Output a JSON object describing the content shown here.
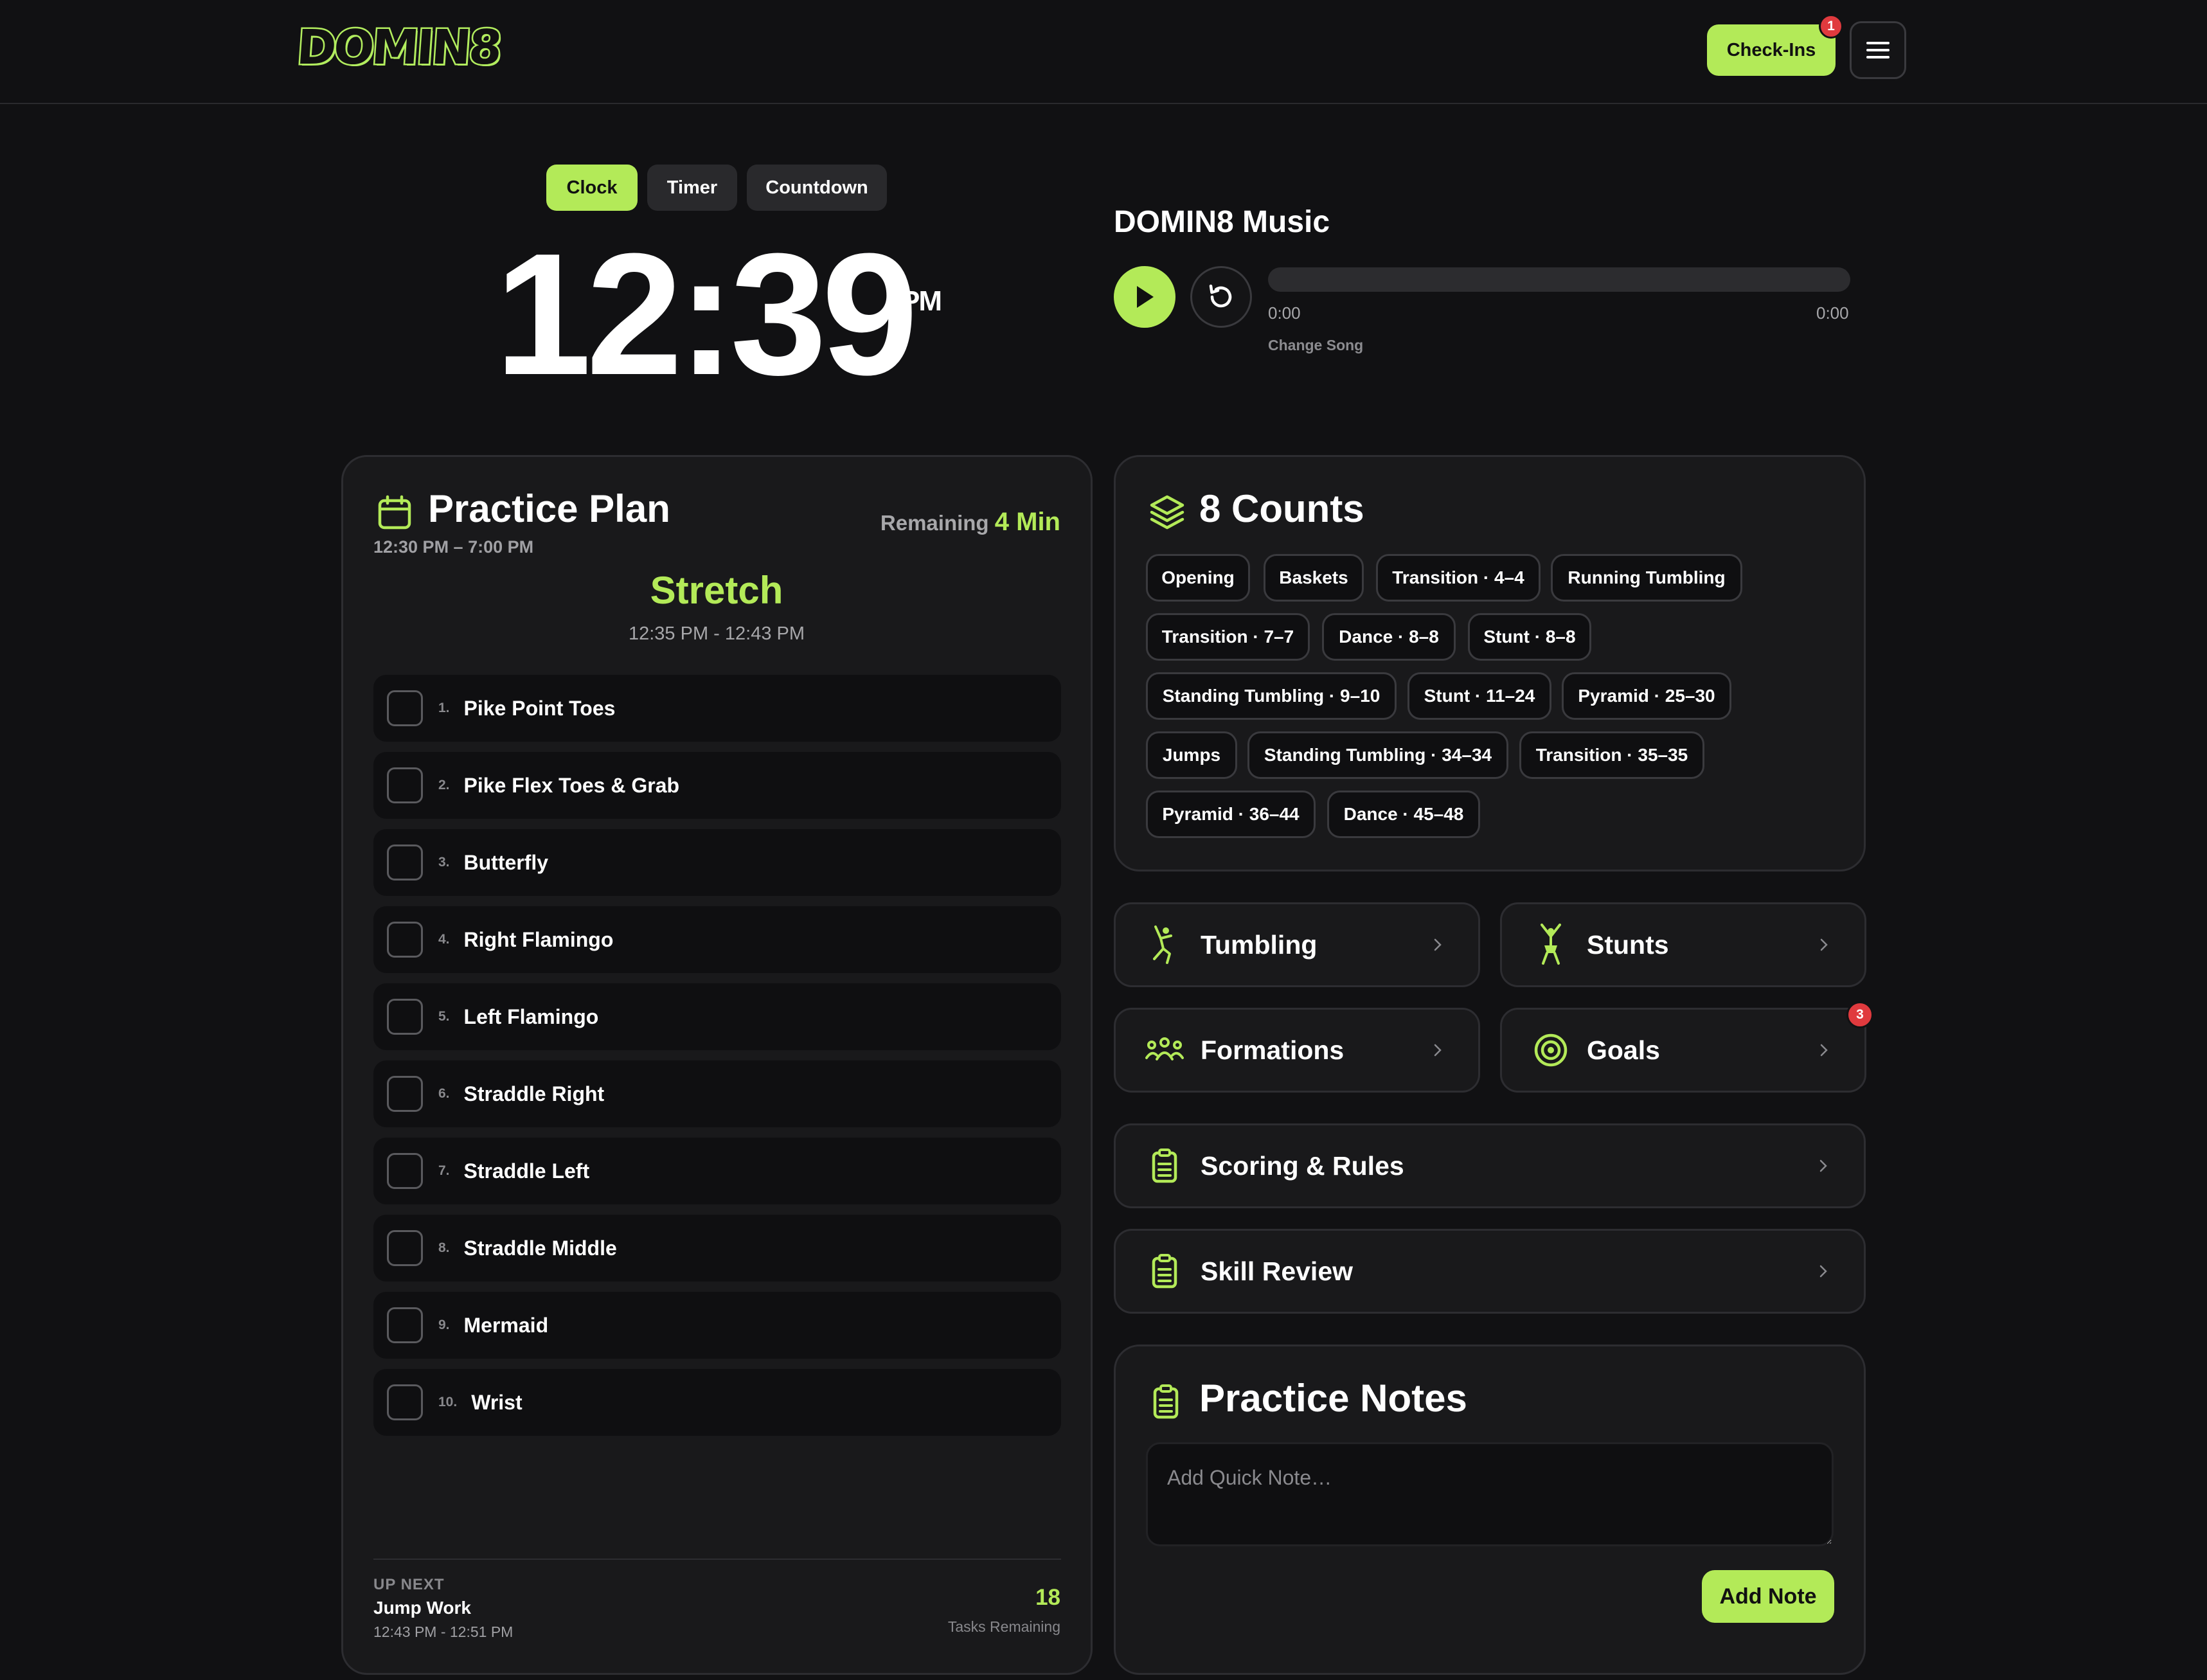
{
  "header": {
    "logo_text": "DOMIN8",
    "checkins_label": "Check-Ins",
    "checkins_badge": "1"
  },
  "clock": {
    "modes": [
      "Clock",
      "Timer",
      "Countdown"
    ],
    "active_mode": "Clock",
    "time": "12:39",
    "ampm": "PM"
  },
  "music": {
    "title": "DOMIN8 Music",
    "current_time": "0:00",
    "duration": "0:00",
    "progress": 0,
    "change_song_label": "Change Song"
  },
  "practice_plan": {
    "title": "Practice Plan",
    "range": "12:30 PM – 7:00 PM",
    "remaining_label": "Remaining",
    "remaining_value": "4 Min",
    "current_block": "Stretch",
    "current_block_time": "12:35 PM - 12:43 PM",
    "tasks": [
      {
        "num": "1.",
        "name": "Pike Point Toes"
      },
      {
        "num": "2.",
        "name": "Pike Flex Toes & Grab"
      },
      {
        "num": "3.",
        "name": "Butterfly"
      },
      {
        "num": "4.",
        "name": "Right Flamingo"
      },
      {
        "num": "5.",
        "name": "Left Flamingo"
      },
      {
        "num": "6.",
        "name": "Straddle Right"
      },
      {
        "num": "7.",
        "name": "Straddle Left"
      },
      {
        "num": "8.",
        "name": "Straddle Middle"
      },
      {
        "num": "9.",
        "name": "Mermaid"
      },
      {
        "num": "10.",
        "name": "Wrist"
      }
    ],
    "up_next_label": "UP NEXT",
    "up_next_name": "Jump Work",
    "up_next_time": "12:43 PM - 12:51 PM",
    "tasks_remaining_count": "18",
    "tasks_remaining_label": "Tasks Remaining"
  },
  "counts": {
    "title": "8 Counts",
    "chips": [
      "Opening",
      "Baskets",
      "Transition · 4–4",
      "Running Tumbling",
      "Transition · 7–7",
      "Dance · 8–8",
      "Stunt · 8–8",
      "Standing Tumbling · 9–10",
      "Stunt · 11–24",
      "Pyramid · 25–30",
      "Jumps",
      "Standing Tumbling · 34–34",
      "Transition · 35–35",
      "Pyramid · 36–44",
      "Dance · 45–48"
    ]
  },
  "nav": {
    "tumbling": "Tumbling",
    "stunts": "Stunts",
    "formations": "Formations",
    "goals": "Goals",
    "goals_badge": "3",
    "scoring": "Scoring & Rules",
    "skill_review": "Skill Review"
  },
  "notes": {
    "title": "Practice Notes",
    "placeholder": "Add Quick Note…",
    "add_label": "Add Note"
  },
  "colors": {
    "accent": "#b3ea58",
    "background": "#111113",
    "card": "#19191b",
    "badge": "#e03a3e"
  }
}
